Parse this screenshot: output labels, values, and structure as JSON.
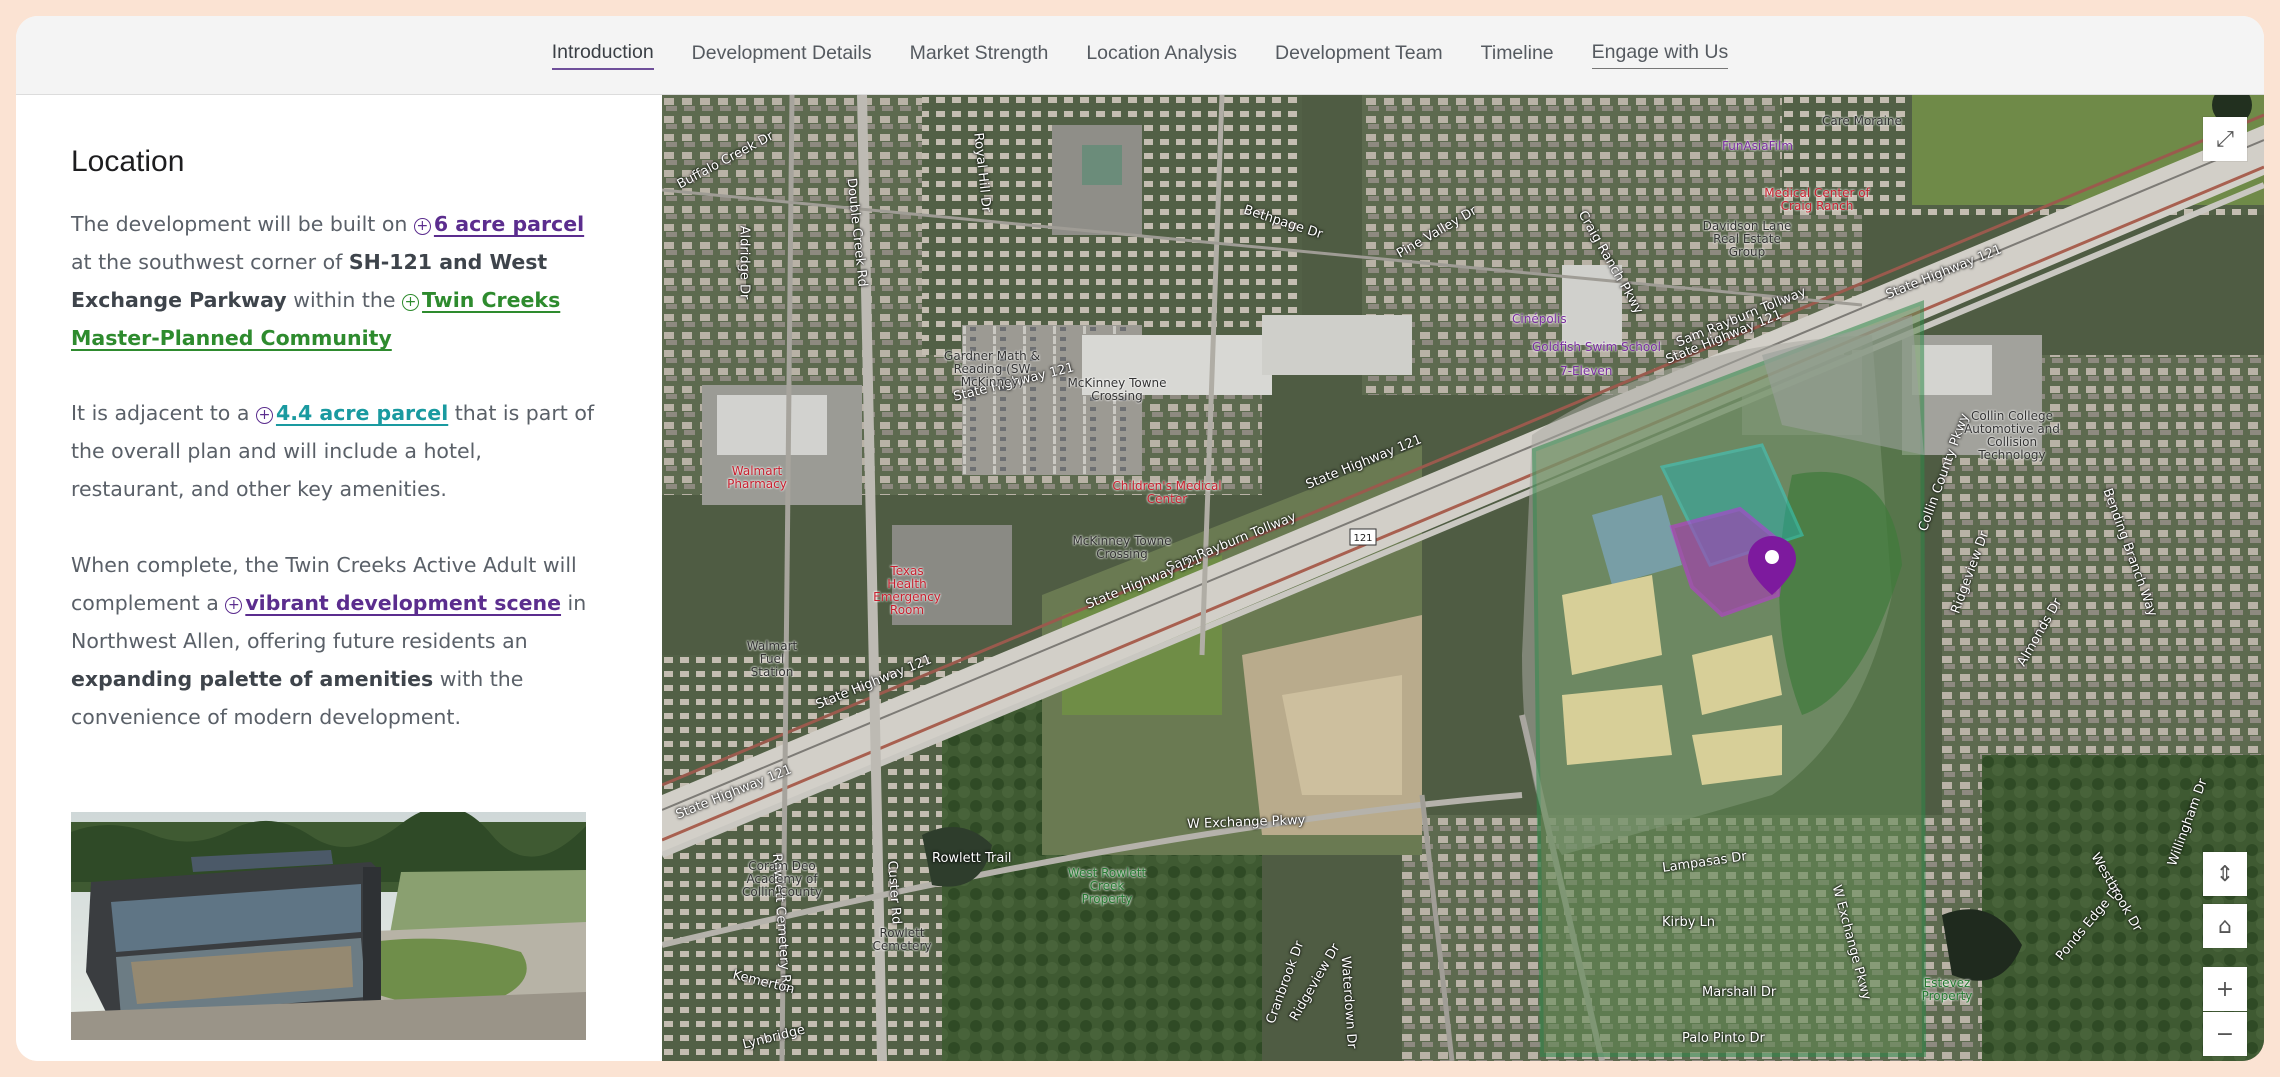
{
  "nav": {
    "items": [
      {
        "label": "Introduction"
      },
      {
        "label": "Development Details"
      },
      {
        "label": "Market Strength"
      },
      {
        "label": "Location Analysis"
      },
      {
        "label": "Development Team"
      },
      {
        "label": "Timeline"
      },
      {
        "label": "Engage with Us"
      }
    ]
  },
  "location": {
    "heading": "Location",
    "p1": {
      "t1": "The development will be built on ",
      "link1": "6 acre parcel",
      "t2": " at the southwest corner of ",
      "b1": "SH-121 and West Exchange Parkway",
      "t3": " within the ",
      "link2": "Twin Creeks Master-Planned Community"
    },
    "p2": {
      "t1": "It is adjacent to a ",
      "link1": "4.4 acre parcel",
      "t2": " that is part of the overall plan and will include a hotel, restaurant, and other key amenities."
    },
    "p3": {
      "t1": "When complete, the Twin Creeks Active Adult will complement a ",
      "link1": "vibrant development scene",
      "t2": " in Northwest Allen, offering future residents an ",
      "b1": "expanding palette of amenities",
      "t3": " with the convenience of modern development."
    }
  },
  "map": {
    "controls": {
      "expand": "⤢",
      "compass": "⇕",
      "home": "⌂",
      "zoom_in": "+",
      "zoom_out": "−"
    },
    "road_labels": [
      "Buffalo Creek Dr",
      "Aldridge Dr",
      "Double Creek Rd",
      "Royal Hill Dr",
      "Bethpage Dr",
      "Pine Valley Dr",
      "Craig Ranch Pkwy",
      "State Highway 121",
      "Sam Rayburn Tollway",
      "State Highway 121",
      "State Highway 121",
      "Sam Rayburn Tollway",
      "State Highway 121",
      "State Highway 121",
      "State Highway 121",
      "W Exchange Pkwy",
      "Rowlett Trail",
      "Custer Rd",
      "Rowlett Cemetery Rd",
      "Kemerton",
      "Lynbridge",
      "Ridgeview Dr",
      "Lampasas Dr",
      "Kirby Ln",
      "Marshall Dr",
      "Palo Pinto Dr",
      "W Exchange Pkwy",
      "Ridgeview Dr",
      "Almonds Dr",
      "Ponds Edge Dr",
      "Willingham Dr",
      "Westbrook Dr",
      "Bending Branch Way",
      "Collin County Pkwy",
      "State Highway 121",
      "Waterdown Dr",
      "Cranbrook Dr"
    ],
    "poi_labels": [
      {
        "text": "Care Moraine"
      },
      {
        "text": "FunAsiaFilm"
      },
      {
        "text": "Medical Center of Craig Ranch"
      },
      {
        "text": "Davidson Lane Real Estate Group"
      },
      {
        "text": "Cinépolis"
      },
      {
        "text": "7-Eleven"
      },
      {
        "text": "Goldfish Swim School"
      },
      {
        "text": "Gardner Math & Reading (SW McKinney)"
      },
      {
        "text": "McKinney Towne Crossing"
      },
      {
        "text": "Children's Medical Center"
      },
      {
        "text": "McKinney Towne Crossing"
      },
      {
        "text": "Walmart Pharmacy"
      },
      {
        "text": "Texas Health Emergency Room"
      },
      {
        "text": "Walmart Fuel Station"
      },
      {
        "text": "Collin College Automotive and Collision Technology"
      },
      {
        "text": "Coram Deo Academy of Collin County"
      },
      {
        "text": "West Rowlett Creek Property"
      },
      {
        "text": "Rowlett Cemetery"
      },
      {
        "text": "Estevez Property"
      }
    ],
    "shield": "121"
  }
}
